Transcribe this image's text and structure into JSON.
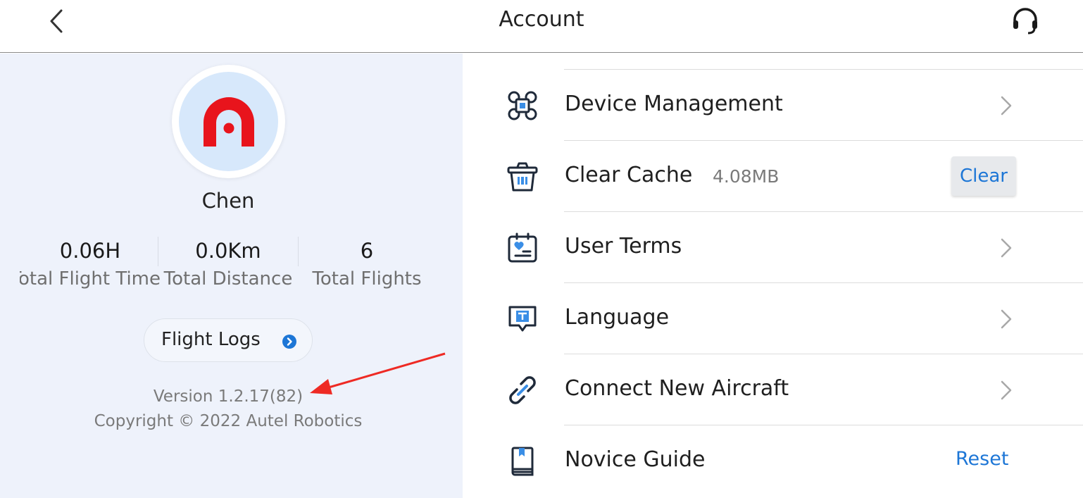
{
  "header": {
    "title": "Account",
    "back_icon": "chevron-left-icon",
    "support_icon": "headset-icon"
  },
  "profile": {
    "avatar_icon": "autel-logo-icon",
    "username": "Chen",
    "stats": [
      {
        "value": "0.06H",
        "label": "Total Flight Time"
      },
      {
        "value": "0.0Km",
        "label": "Total Distance"
      },
      {
        "value": "6",
        "label": "Total Flights"
      }
    ],
    "flight_logs_label": "Flight Logs",
    "version": "Version 1.2.17(82)",
    "copyright": "Copyright © 2022 Autel Robotics"
  },
  "menu": {
    "device_management": "Device Management",
    "clear_cache": "Clear Cache",
    "cache_size": "4.08MB",
    "clear_button": "Clear",
    "user_terms": "User Terms",
    "language": "Language",
    "connect_aircraft": "Connect New Aircraft",
    "novice_guide": "Novice Guide",
    "reset_button": "Reset"
  },
  "colors": {
    "accent": "#1d76d6",
    "left_panel_bg": "#eef2fb",
    "logo_red": "#e8141c",
    "annotation_arrow": "#ee2a24"
  }
}
